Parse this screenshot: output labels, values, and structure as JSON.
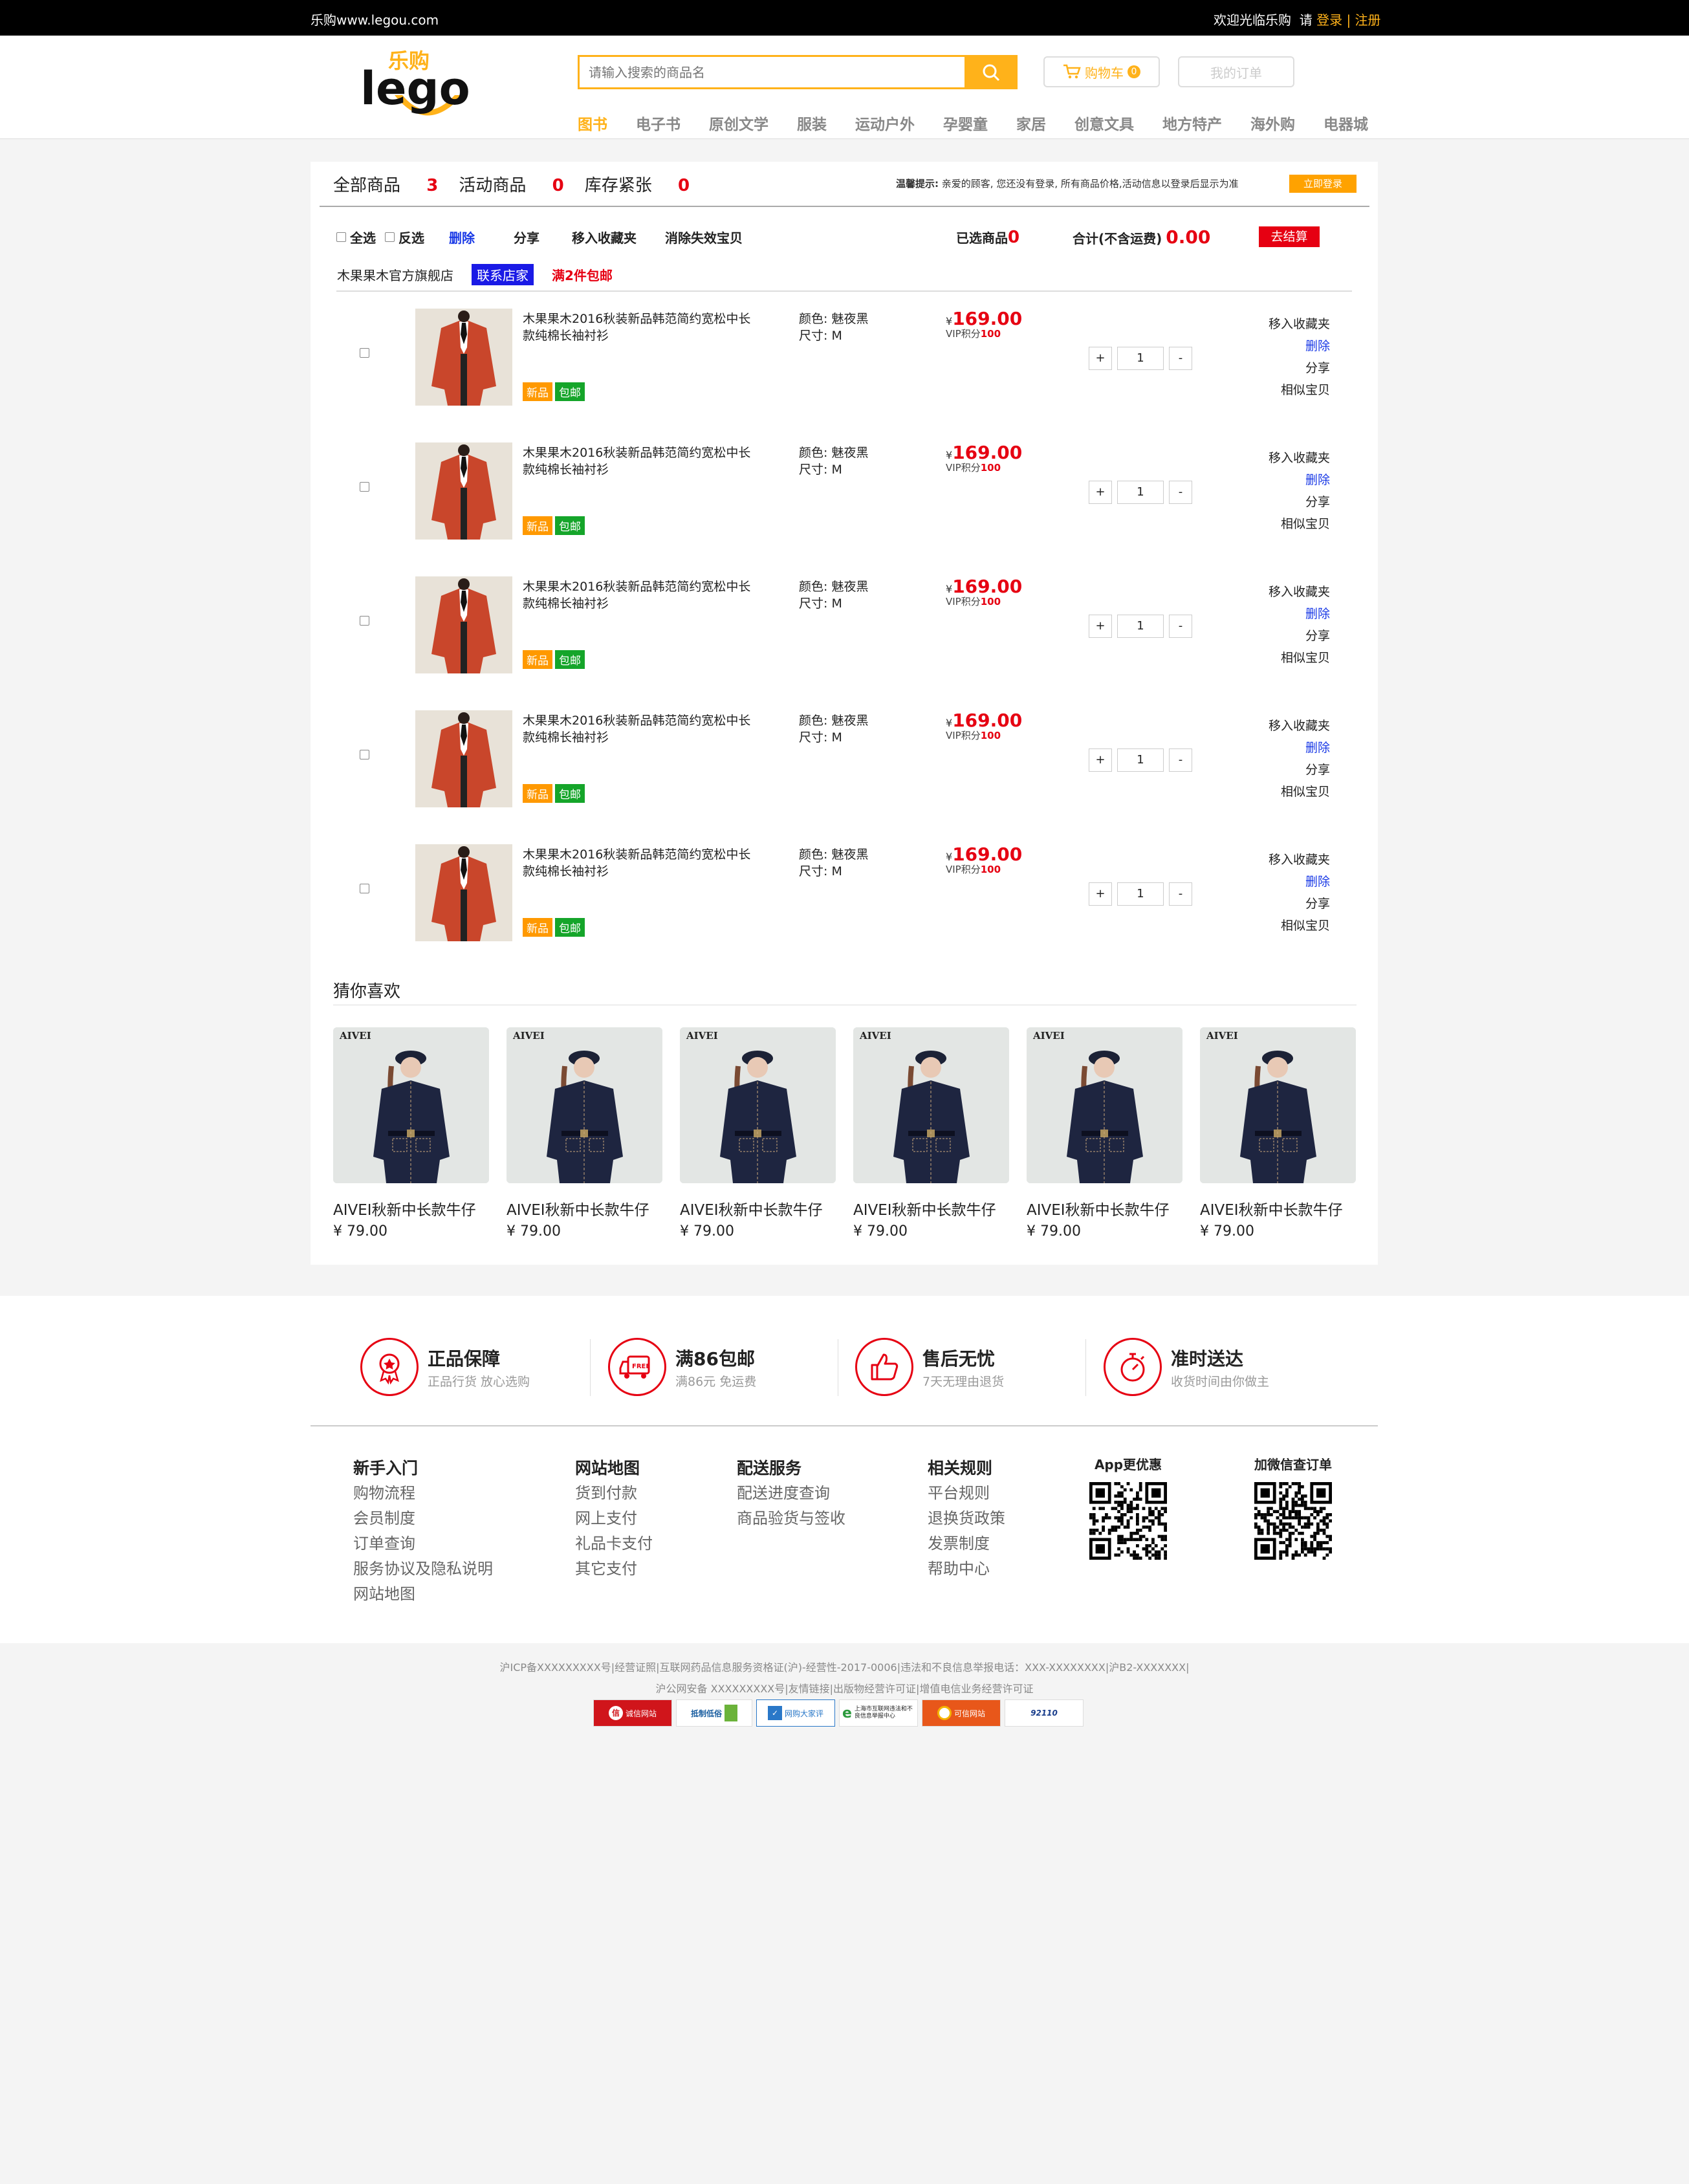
{
  "topbar": {
    "site": "乐购www.legou.com",
    "welcome": "欢迎光临乐购",
    "please": "请",
    "login": "登录",
    "sep": "|",
    "register": "注册"
  },
  "header": {
    "logo_text": "lego",
    "logo_cn": "乐购",
    "search_placeholder": "请输入搜索的商品名",
    "cart_label": "购物车",
    "cart_count": "0",
    "orders_label": "我的订单",
    "nav": [
      "图书",
      "电子书",
      "原创文学",
      "服装",
      "运动户外",
      "孕婴童",
      "家居",
      "创意文具",
      "地方特产",
      "海外购",
      "电器城"
    ]
  },
  "cart": {
    "tabs": [
      {
        "label": "全部商品",
        "count": "3"
      },
      {
        "label": "活动商品",
        "count": "0"
      },
      {
        "label": "库存紧张",
        "count": "0"
      }
    ],
    "tip_label": "温馨提示:",
    "tip_text": "亲爱的顾客, 您还没有登录, 所有商品价格,活动信息以登录后显示为准",
    "login_now": "立即登录",
    "select_all": "全选",
    "invert": "反选",
    "delete": "删除",
    "share": "分享",
    "move_fav": "移入收藏夹",
    "clear_invalid": "消除失效宝贝",
    "selected_label": "已选商品",
    "selected_count": "0",
    "total_label": "合计(不含运费)",
    "total_value": "0.00",
    "checkout": "去结算",
    "shop_name": "木果果木官方旗舰店",
    "contact": "联系店家",
    "free_ship": "满2件包邮",
    "items": [
      {
        "title": "木果果木2016秋装新品韩范简约宽松中长款纯棉长袖衬衫",
        "color": "颜色: 魅夜黑",
        "size": "尺寸: M",
        "currency": "¥",
        "price": "169.00",
        "vip_label": "VIP积分",
        "vip": "100",
        "qty": "1",
        "tag_new": "新品",
        "tag_ship": "包邮",
        "op_fav": "移入收藏夹",
        "op_del": "删除",
        "op_share": "分享",
        "op_similar": "相似宝贝"
      },
      {
        "title": "木果果木2016秋装新品韩范简约宽松中长款纯棉长袖衬衫",
        "color": "颜色: 魅夜黑",
        "size": "尺寸: M",
        "currency": "¥",
        "price": "169.00",
        "vip_label": "VIP积分",
        "vip": "100",
        "qty": "1",
        "tag_new": "新品",
        "tag_ship": "包邮",
        "op_fav": "移入收藏夹",
        "op_del": "删除",
        "op_share": "分享",
        "op_similar": "相似宝贝"
      },
      {
        "title": "木果果木2016秋装新品韩范简约宽松中长款纯棉长袖衬衫",
        "color": "颜色: 魅夜黑",
        "size": "尺寸: M",
        "currency": "¥",
        "price": "169.00",
        "vip_label": "VIP积分",
        "vip": "100",
        "qty": "1",
        "tag_new": "新品",
        "tag_ship": "包邮",
        "op_fav": "移入收藏夹",
        "op_del": "删除",
        "op_share": "分享",
        "op_similar": "相似宝贝"
      },
      {
        "title": "木果果木2016秋装新品韩范简约宽松中长款纯棉长袖衬衫",
        "color": "颜色: 魅夜黑",
        "size": "尺寸: M",
        "currency": "¥",
        "price": "169.00",
        "vip_label": "VIP积分",
        "vip": "100",
        "qty": "1",
        "tag_new": "新品",
        "tag_ship": "包邮",
        "op_fav": "移入收藏夹",
        "op_del": "删除",
        "op_share": "分享",
        "op_similar": "相似宝贝"
      },
      {
        "title": "木果果木2016秋装新品韩范简约宽松中长款纯棉长袖衬衫",
        "color": "颜色: 魅夜黑",
        "size": "尺寸: M",
        "currency": "¥",
        "price": "169.00",
        "vip_label": "VIP积分",
        "vip": "100",
        "qty": "1",
        "tag_new": "新品",
        "tag_ship": "包邮",
        "op_fav": "移入收藏夹",
        "op_del": "删除",
        "op_share": "分享",
        "op_similar": "相似宝贝"
      }
    ]
  },
  "recommend": {
    "title": "猜你喜欢",
    "items": [
      {
        "brand": "AIVEI",
        "name": "AIVEI秋新中长款牛仔",
        "price": "¥ 79.00"
      },
      {
        "brand": "AIVEI",
        "name": "AIVEI秋新中长款牛仔",
        "price": "¥ 79.00"
      },
      {
        "brand": "AIVEI",
        "name": "AIVEI秋新中长款牛仔",
        "price": "¥ 79.00"
      },
      {
        "brand": "AIVEI",
        "name": "AIVEI秋新中长款牛仔",
        "price": "¥ 79.00"
      },
      {
        "brand": "AIVEI",
        "name": "AIVEI秋新中长款牛仔",
        "price": "¥ 79.00"
      },
      {
        "brand": "AIVEI",
        "name": "AIVEI秋新中长款牛仔",
        "price": "¥ 79.00"
      }
    ]
  },
  "footer": {
    "features": [
      {
        "icon": "badge-icon",
        "title": "正品保障",
        "sub": "正品行货 放心选购"
      },
      {
        "icon": "truck-icon",
        "title": "满86包邮",
        "sub": "满86元 免运费"
      },
      {
        "icon": "thumb-up-icon",
        "title": "售后无忧",
        "sub": "7天无理由退货"
      },
      {
        "icon": "stopwatch-icon",
        "title": "准时送达",
        "sub": "收货时间由你做主"
      }
    ],
    "columns": [
      {
        "title": "新手入门",
        "links": [
          "购物流程",
          "会员制度",
          "订单查询",
          "服务协议及隐私说明",
          "网站地图"
        ]
      },
      {
        "title": "网站地图",
        "links": [
          "货到付款",
          "网上支付",
          "礼品卡支付",
          "其它支付"
        ]
      },
      {
        "title": "配送服务",
        "links": [
          "配送进度查询",
          "商品验货与签收"
        ]
      },
      {
        "title": "相关规则",
        "links": [
          "平台规则",
          "退换货政策",
          "发票制度",
          "帮助中心"
        ]
      }
    ],
    "qr_app": "App更优惠",
    "qr_wechat": "加微信查订单",
    "legal1": "沪ICP备XXXXXXXXX号|经营证照|互联网药品信息服务资格证(沪)-经营性-2017-0006|违法和不良信息举报电话：XXX-XXXXXXXX|沪B2-XXXXXXX|",
    "legal2": "沪公网安备 XXXXXXXXX号|友情链接|出版物经营许可证|增值电信业务经营许可证",
    "badges": [
      "诚信网站",
      "抵制低俗",
      "网购大家评",
      "上海市互联网违法和不良信息举报中心",
      "可信网站",
      "92110"
    ]
  },
  "colors": {
    "accent": "#ffb21a",
    "price_red": "#e60012",
    "tag_green": "#15a52a",
    "contact_blue": "#1a1ae6"
  }
}
